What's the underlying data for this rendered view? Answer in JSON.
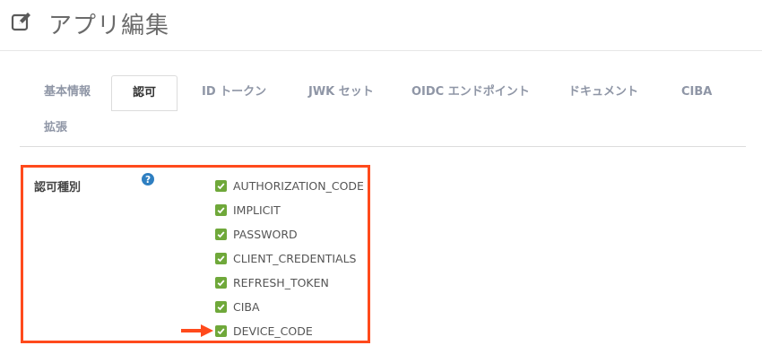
{
  "header": {
    "title": "アプリ編集"
  },
  "tabs": [
    {
      "label": "基本情報"
    },
    {
      "label": "認可"
    },
    {
      "label": "ID トークン"
    },
    {
      "label": "JWK セット"
    },
    {
      "label": "OIDC エンドポイント"
    },
    {
      "label": "ドキュメント"
    },
    {
      "label": "CIBA"
    },
    {
      "label": "拡張"
    }
  ],
  "active_tab": "認可",
  "grant_types": {
    "label": "認可種別",
    "help_icon": "question-circle-icon",
    "options": [
      {
        "label": "AUTHORIZATION_CODE",
        "checked": true
      },
      {
        "label": "IMPLICIT",
        "checked": true
      },
      {
        "label": "PASSWORD",
        "checked": true
      },
      {
        "label": "CLIENT_CREDENTIALS",
        "checked": true
      },
      {
        "label": "REFRESH_TOKEN",
        "checked": true
      },
      {
        "label": "CIBA",
        "checked": true
      },
      {
        "label": "DEVICE_CODE",
        "checked": true
      }
    ]
  },
  "colors": {
    "highlight_border": "#ff4a1c",
    "arrow": "#ff4a1c",
    "checkbox": "#6fa83a",
    "help_icon": "#2f7fc1"
  }
}
